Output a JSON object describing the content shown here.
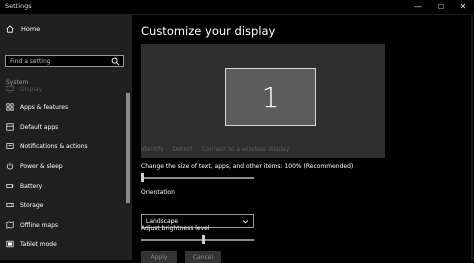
{
  "window": {
    "title": "Settings",
    "min_glyph": "—",
    "max_glyph": "☐",
    "close_glyph": "✕"
  },
  "sidebar": {
    "home_label": "Home",
    "search_placeholder": "Find a setting",
    "section_label": "System",
    "items": [
      {
        "label": "Display",
        "icon": "display-icon",
        "selected": true
      },
      {
        "label": "Apps & features",
        "icon": "apps-icon"
      },
      {
        "label": "Default apps",
        "icon": "default-apps-icon"
      },
      {
        "label": "Notifications & actions",
        "icon": "notifications-icon"
      },
      {
        "label": "Power & sleep",
        "icon": "power-icon"
      },
      {
        "label": "Battery",
        "icon": "battery-icon"
      },
      {
        "label": "Storage",
        "icon": "storage-icon"
      },
      {
        "label": "Offline maps",
        "icon": "offline-maps-icon"
      },
      {
        "label": "Tablet mode",
        "icon": "tablet-mode-icon"
      }
    ]
  },
  "main": {
    "heading": "Customize your display",
    "monitor_number": "1",
    "links": [
      "Identify",
      "Detect",
      "Connect to a wireless display"
    ],
    "scale_label": "Change the size of text, apps, and other items: 100% (Recommended)",
    "scale_slider_fraction": 0.0,
    "orientation_label": "Orientation",
    "orientation_value": "Landscape",
    "brightness_label": "Adjust brightness level",
    "brightness_fraction": 0.55,
    "apply_label": "Apply",
    "cancel_label": "Cancel"
  },
  "colors": {
    "sidebar_bg": "#1f1f1f",
    "content_bg": "#000000",
    "preview_bg": "#2f2f2f",
    "monitor_fill": "#5c5c5c"
  }
}
